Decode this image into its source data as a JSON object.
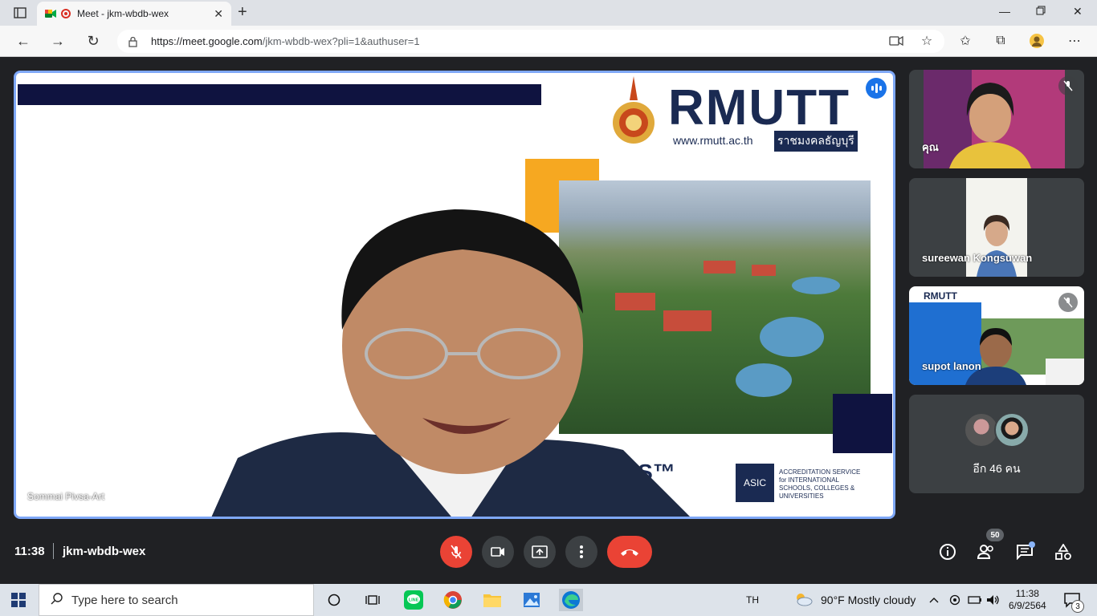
{
  "browser": {
    "tab_title": "Meet - jkm-wbdb-wex",
    "url_host": "https://meet.google.com",
    "url_path": "/jkm-wbdb-wex?pli=1&authuser=1"
  },
  "slide": {
    "brand": "RMUTT",
    "website": "www.rmutt.ac.th",
    "brand_thai": "ราชมงคลธัญบุรี",
    "stars": "STARS™",
    "asic_label": "ASIC",
    "asic_text": "ACCREDITATION SERVICE for INTERNATIONAL SCHOOLS, COLLEGES & UNIVERSITIES"
  },
  "stage": {
    "speaker_name": "Sommai Pivsa-Art"
  },
  "participants": [
    {
      "name": "คุณ"
    },
    {
      "name": "sureewan Kongsuwan"
    },
    {
      "name": "supot lanon"
    }
  ],
  "more": {
    "label": "อีก 46 คน"
  },
  "bottom": {
    "time": "11:38",
    "meeting_code": "jkm-wbdb-wex",
    "people_count": "50"
  },
  "taskbar": {
    "search_placeholder": "Type here to search",
    "lang": "TH",
    "weather": "90°F  Mostly cloudy",
    "clock_time": "11:38",
    "clock_date": "6/9/2564",
    "notif_count": "3"
  }
}
